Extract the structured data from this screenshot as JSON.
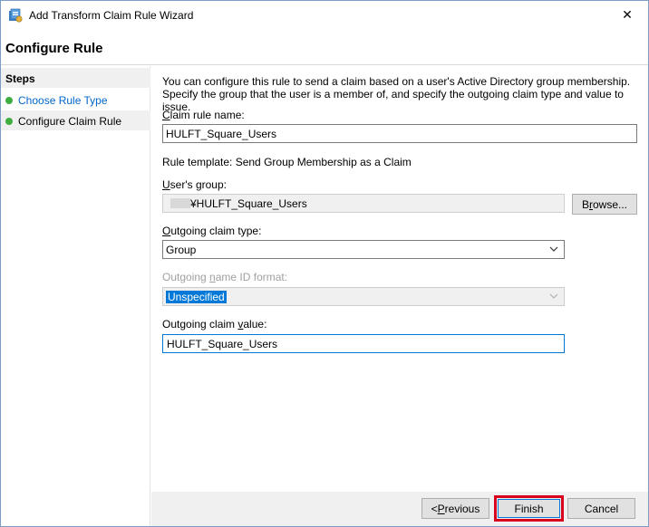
{
  "window": {
    "title": "Add Transform Claim Rule Wizard",
    "close_glyph": "✕",
    "icon": "wizard-app-icon"
  },
  "header": {
    "title": "Configure Rule"
  },
  "steps": {
    "heading": "Steps",
    "items": [
      {
        "label": "Choose Rule Type",
        "state": "link"
      },
      {
        "label": "Configure Claim Rule",
        "state": "current"
      }
    ]
  },
  "form": {
    "description": "You can configure this rule to send a claim based on a user's Active Directory group membership. Specify the group that the user is a member of, and specify the outgoing claim type and value to issue.",
    "claim_rule_name": {
      "label_key": "C",
      "label_rest": "laim rule name:",
      "value": "HULFT_Square_Users"
    },
    "rule_template": "Rule template: Send Group Membership as a Claim",
    "users_group": {
      "label_key": "U",
      "label_rest": "ser's group:",
      "value": "¥HULFT_Square_Users",
      "browse_pre": "B",
      "browse_key": "r",
      "browse_post": "owse..."
    },
    "outgoing_claim_type": {
      "label_pre": "",
      "label_key": "O",
      "label_rest": "utgoing claim type:",
      "value": "Group"
    },
    "outgoing_name_id_format": {
      "label_pre": "Outgoing ",
      "label_key": "n",
      "label_rest": "ame ID format:",
      "value": "Unspecified"
    },
    "outgoing_claim_value": {
      "label_pre": "Outgoing claim ",
      "label_key": "v",
      "label_rest": "alue:",
      "value": "HULFT_Square_Users"
    }
  },
  "footer": {
    "previous_pre": "< ",
    "previous_key": "P",
    "previous_rest": "revious",
    "finish": "Finish",
    "cancel": "Cancel"
  },
  "colors": {
    "accent": "#0078d7",
    "link": "#0066cc",
    "step_dot": "#3fae3f",
    "highlight_border": "#d9001e"
  }
}
